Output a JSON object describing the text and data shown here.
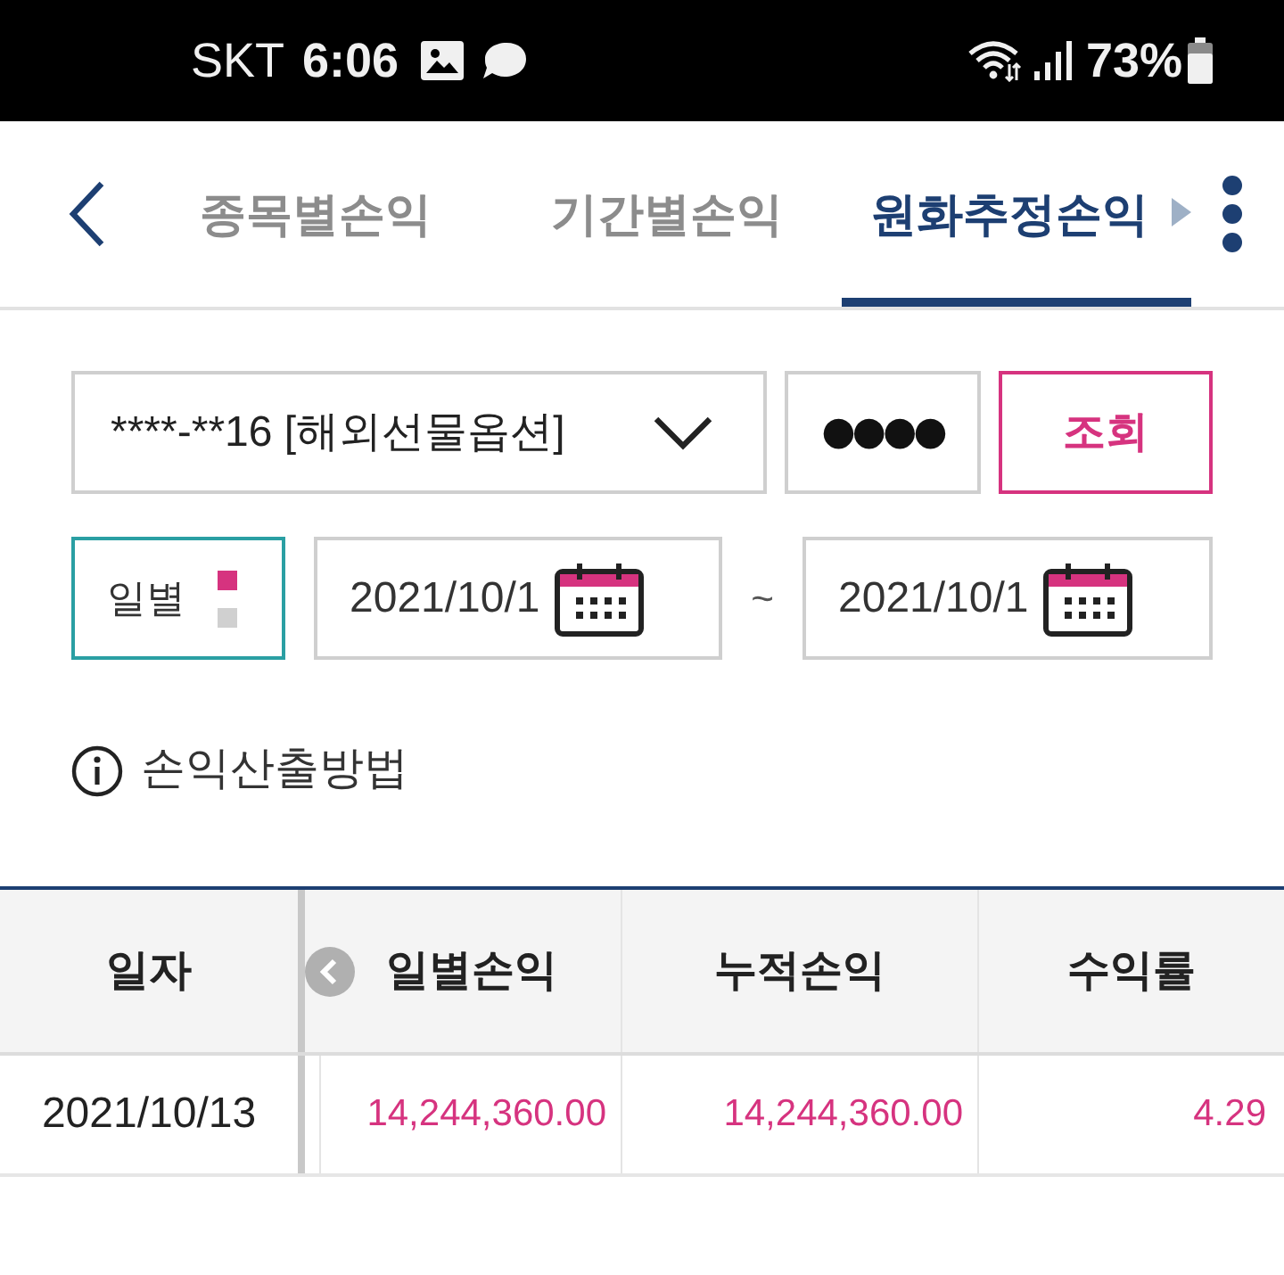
{
  "status_bar": {
    "carrier": "SKT",
    "time": "6:06",
    "battery": "73%"
  },
  "tabs": [
    {
      "label": "종목별손익",
      "selected": false
    },
    {
      "label": "기간별손익",
      "selected": false
    },
    {
      "label": "원화추정손익",
      "selected": true
    }
  ],
  "query": {
    "account": "****-**16 [해외선물옵션]",
    "password": "●●●●",
    "search_button": "조회"
  },
  "period": {
    "label": "일별",
    "indicator": [
      {
        "selected": true
      },
      {
        "selected": false
      }
    ],
    "from": "2021/10/1",
    "separator": "~",
    "to": "2021/10/1"
  },
  "info_link": "손익산출방법",
  "table": {
    "columns": [
      "일자",
      "일별손익",
      "누적손익",
      "수익률"
    ],
    "rows": [
      [
        "2021/10/13",
        "14,244,360.00",
        "14,244,360.00",
        "4.29"
      ]
    ]
  }
}
